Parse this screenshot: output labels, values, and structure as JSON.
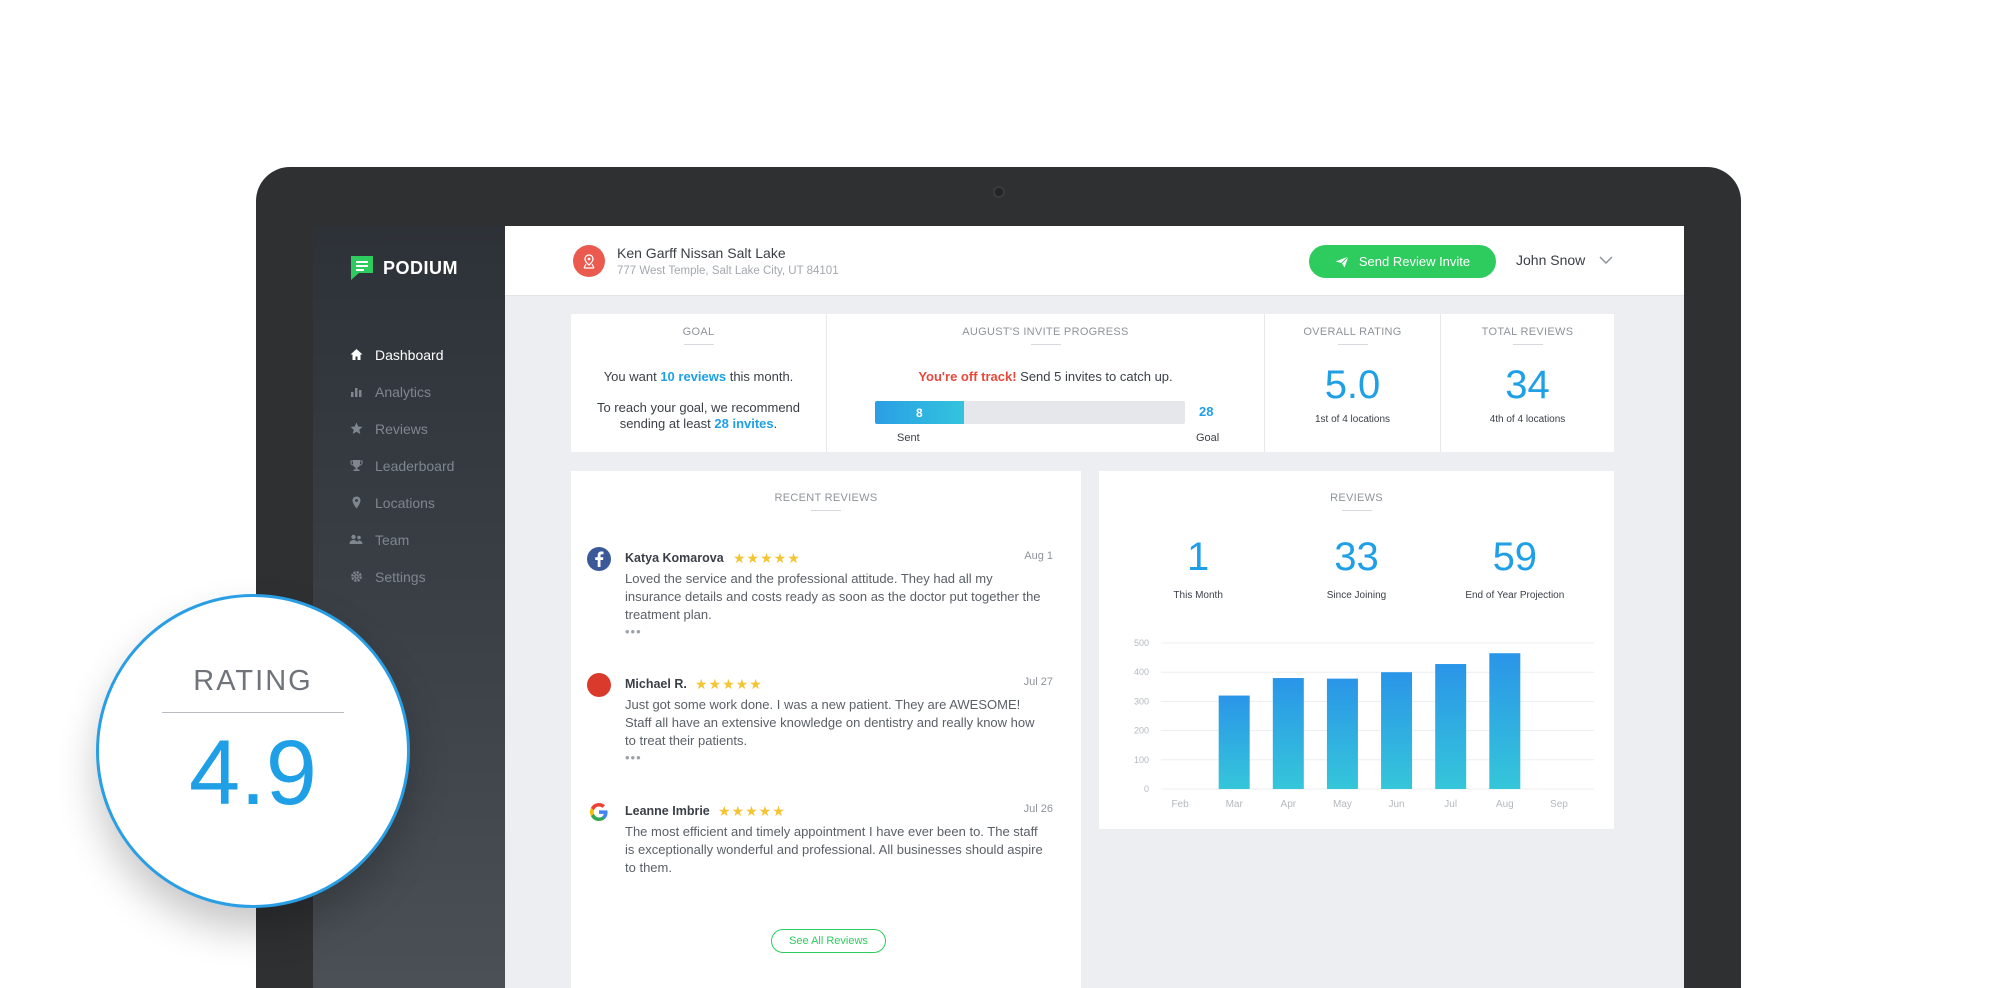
{
  "brand": {
    "name": "PODIUM",
    "accent": "#2ecc5e",
    "blue": "#1fa0e6"
  },
  "sidebar": {
    "items": [
      {
        "label": "Dashboard",
        "icon": "home-icon",
        "active": true
      },
      {
        "label": "Analytics",
        "icon": "bar-chart-icon",
        "active": false
      },
      {
        "label": "Reviews",
        "icon": "star-icon",
        "active": false
      },
      {
        "label": "Leaderboard",
        "icon": "trophy-icon",
        "active": false
      },
      {
        "label": "Locations",
        "icon": "map-pin-icon",
        "active": false
      },
      {
        "label": "Team",
        "icon": "users-icon",
        "active": false
      },
      {
        "label": "Settings",
        "icon": "gear-icon",
        "active": false
      }
    ]
  },
  "header": {
    "location_name": "Ken Garff Nissan Salt Lake",
    "location_address": "777 West Temple, Salt Lake City, UT 84101",
    "send_button": "Send Review Invite",
    "user_name": "John Snow"
  },
  "goal": {
    "title": "GOAL",
    "line1_pre": "You want ",
    "line1_highlight": "10 reviews",
    "line1_post": " this month.",
    "line2_pre": "To reach your goal, we recommend sending at least ",
    "line2_highlight": "28 invites",
    "line2_post": "."
  },
  "invite_progress": {
    "title": "AUGUST'S INVITE PROGRESS",
    "alert": "You're off track!",
    "message": " Send 5 invites to catch up.",
    "sent": 8,
    "goal": 28,
    "sent_label": "Sent",
    "goal_label": "Goal"
  },
  "overall_rating": {
    "title": "OVERALL RATING",
    "value": "5.0",
    "subtitle": "1st of 4 locations"
  },
  "total_reviews": {
    "title": "TOTAL REVIEWS",
    "value": "34",
    "subtitle": "4th of 4 locations"
  },
  "recent_reviews": {
    "title": "RECENT REVIEWS",
    "items": [
      {
        "name": "Katya Komarova",
        "source": "facebook-icon",
        "stars": "★★★★★",
        "date": "Aug 1",
        "text": "Loved the service and the professional attitude. They had all my insurance details and costs ready as soon as the doctor put together the treatment plan.",
        "more": "•••"
      },
      {
        "name": "Michael R.",
        "source": "red-circle-icon",
        "stars": "★★★★★",
        "date": "Jul 27",
        "text": "Just got some work done. I was a new patient. They are AWESOME! Staff all have an extensive knowledge on dentistry and really know how to treat their patients.",
        "more": "•••"
      },
      {
        "name": "Leanne Imbrie",
        "source": "google-icon",
        "stars": "★★★★★",
        "date": "Jul 26",
        "text": "The most efficient and timely appointment I have ever been to. The staff is exceptionally wonderful and professional. All businesses should aspire to them.",
        "more": ""
      }
    ],
    "see_all": "See All Reviews"
  },
  "reviews_summary": {
    "title": "REVIEWS",
    "kpis": [
      {
        "value": "1",
        "label": "This Month"
      },
      {
        "value": "33",
        "label": "Since Joining"
      },
      {
        "value": "59",
        "label": "End of Year Projection"
      }
    ]
  },
  "chart_data": {
    "type": "bar",
    "categories": [
      "Feb",
      "Mar",
      "Apr",
      "May",
      "Jun",
      "Jul",
      "Aug",
      "Sep"
    ],
    "values": [
      null,
      320,
      380,
      378,
      400,
      428,
      465,
      null
    ],
    "ylim": [
      0,
      500
    ],
    "yticks": [
      0,
      100,
      200,
      300,
      400,
      500
    ],
    "grid": true,
    "colors": {
      "top": "#2a95e8",
      "bottom": "#35c6da"
    }
  },
  "rating_badge": {
    "title": "RATING",
    "value": "4.9"
  }
}
